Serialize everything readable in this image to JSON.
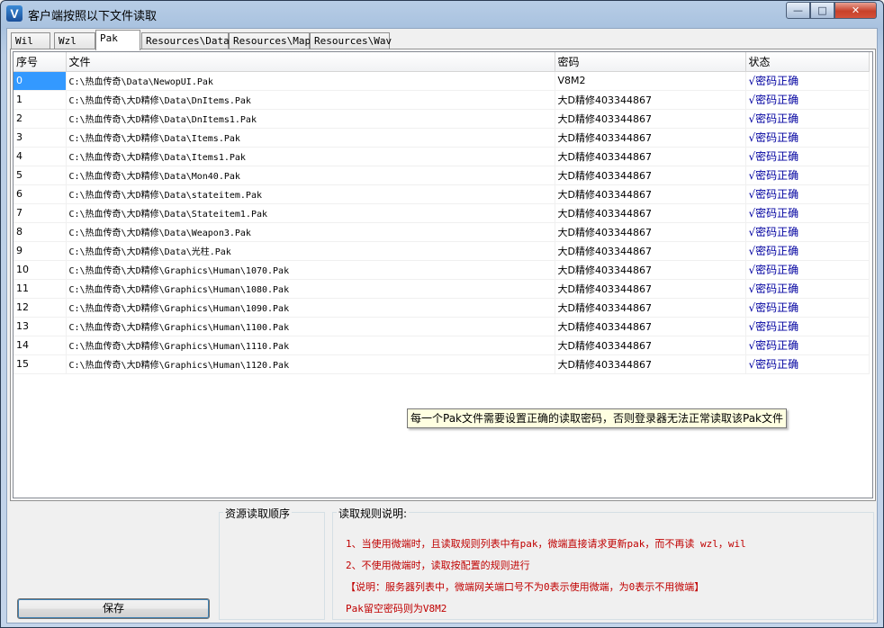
{
  "window": {
    "title": "客户端按照以下文件读取",
    "app_icon": "V",
    "controls": {
      "minimize": "—",
      "maximize": "□",
      "close": "✕"
    }
  },
  "tabs": [
    {
      "label": "Wil",
      "active": false
    },
    {
      "label": "Wzl",
      "active": false
    },
    {
      "label": "Pak",
      "active": true
    },
    {
      "label": "Resources\\Data",
      "active": false
    },
    {
      "label": "Resources\\Map",
      "active": false
    },
    {
      "label": "Resources\\Wav",
      "active": false
    }
  ],
  "table": {
    "columns": [
      "序号",
      "文件",
      "密码",
      "状态"
    ],
    "rows": [
      {
        "idx": "0",
        "file": "C:\\热血传奇\\Data\\NewopUI.Pak",
        "pwd": "V8M2",
        "state": "√密码正确"
      },
      {
        "idx": "1",
        "file": "C:\\热血传奇\\大D精修\\Data\\DnItems.Pak",
        "pwd": "大D精修403344867",
        "state": "√密码正确"
      },
      {
        "idx": "2",
        "file": "C:\\热血传奇\\大D精修\\Data\\DnItems1.Pak",
        "pwd": "大D精修403344867",
        "state": "√密码正确"
      },
      {
        "idx": "3",
        "file": "C:\\热血传奇\\大D精修\\Data\\Items.Pak",
        "pwd": "大D精修403344867",
        "state": "√密码正确"
      },
      {
        "idx": "4",
        "file": "C:\\热血传奇\\大D精修\\Data\\Items1.Pak",
        "pwd": "大D精修403344867",
        "state": "√密码正确"
      },
      {
        "idx": "5",
        "file": "C:\\热血传奇\\大D精修\\Data\\Mon40.Pak",
        "pwd": "大D精修403344867",
        "state": "√密码正确"
      },
      {
        "idx": "6",
        "file": "C:\\热血传奇\\大D精修\\Data\\stateitem.Pak",
        "pwd": "大D精修403344867",
        "state": "√密码正确"
      },
      {
        "idx": "7",
        "file": "C:\\热血传奇\\大D精修\\Data\\Stateitem1.Pak",
        "pwd": "大D精修403344867",
        "state": "√密码正确"
      },
      {
        "idx": "8",
        "file": "C:\\热血传奇\\大D精修\\Data\\Weapon3.Pak",
        "pwd": "大D精修403344867",
        "state": "√密码正确"
      },
      {
        "idx": "9",
        "file": "C:\\热血传奇\\大D精修\\Data\\光柱.Pak",
        "pwd": "大D精修403344867",
        "state": "√密码正确"
      },
      {
        "idx": "10",
        "file": "C:\\热血传奇\\大D精修\\Graphics\\Human\\1070.Pak",
        "pwd": "大D精修403344867",
        "state": "√密码正确"
      },
      {
        "idx": "11",
        "file": "C:\\热血传奇\\大D精修\\Graphics\\Human\\1080.Pak",
        "pwd": "大D精修403344867",
        "state": "√密码正确"
      },
      {
        "idx": "12",
        "file": "C:\\热血传奇\\大D精修\\Graphics\\Human\\1090.Pak",
        "pwd": "大D精修403344867",
        "state": "√密码正确"
      },
      {
        "idx": "13",
        "file": "C:\\热血传奇\\大D精修\\Graphics\\Human\\1100.Pak",
        "pwd": "大D精修403344867",
        "state": "√密码正确"
      },
      {
        "idx": "14",
        "file": "C:\\热血传奇\\大D精修\\Graphics\\Human\\1110.Pak",
        "pwd": "大D精修403344867",
        "state": "√密码正确"
      },
      {
        "idx": "15",
        "file": "C:\\热血传奇\\大D精修\\Graphics\\Human\\1120.Pak",
        "pwd": "大D精修403344867",
        "state": "√密码正确"
      }
    ]
  },
  "tooltip": "每一个Pak文件需要设置正确的读取密码，否则登录器无法正常读取该Pak文件",
  "bottom": {
    "save_label": "保存",
    "order_title": "资源读取顺序",
    "rules_title": "读取规则说明:",
    "rules": [
      "1、当使用微端时，且读取规则列表中有pak，微端直接请求更新pak，而不再读 wzl，wil",
      "2、不使用微端时，读取按配置的规则进行",
      "【说明：服务器列表中，微端网关端口号不为0表示使用微端，为0表示不用微端】",
      "Pak留空密码则为V8M2"
    ]
  }
}
